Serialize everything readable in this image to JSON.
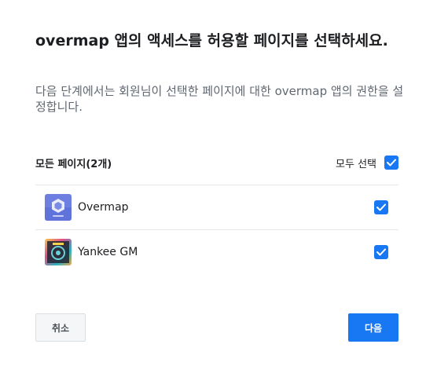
{
  "dialog": {
    "title": "overmap 앱의 액세스를 허용할 페이지를 선택하세요.",
    "description": "다음 단계에서는 회원님이 선택한 페이지에 대한 overmap 앱의 권한을 설정합니다."
  },
  "pages": {
    "header_label": "모든 페이지(2개)",
    "select_all_label": "모두 선택",
    "select_all_checked": true,
    "items": [
      {
        "name": "Overmap",
        "checked": true,
        "icon": "overmap-logo-icon"
      },
      {
        "name": "Yankee GM",
        "checked": true,
        "icon": "yankee-gm-avatar"
      }
    ]
  },
  "footer": {
    "cancel_label": "취소",
    "next_label": "다음"
  },
  "colors": {
    "accent": "#1877f2",
    "text_primary": "#1c1e21",
    "text_secondary": "#606770",
    "divider": "#e4e6eb"
  }
}
